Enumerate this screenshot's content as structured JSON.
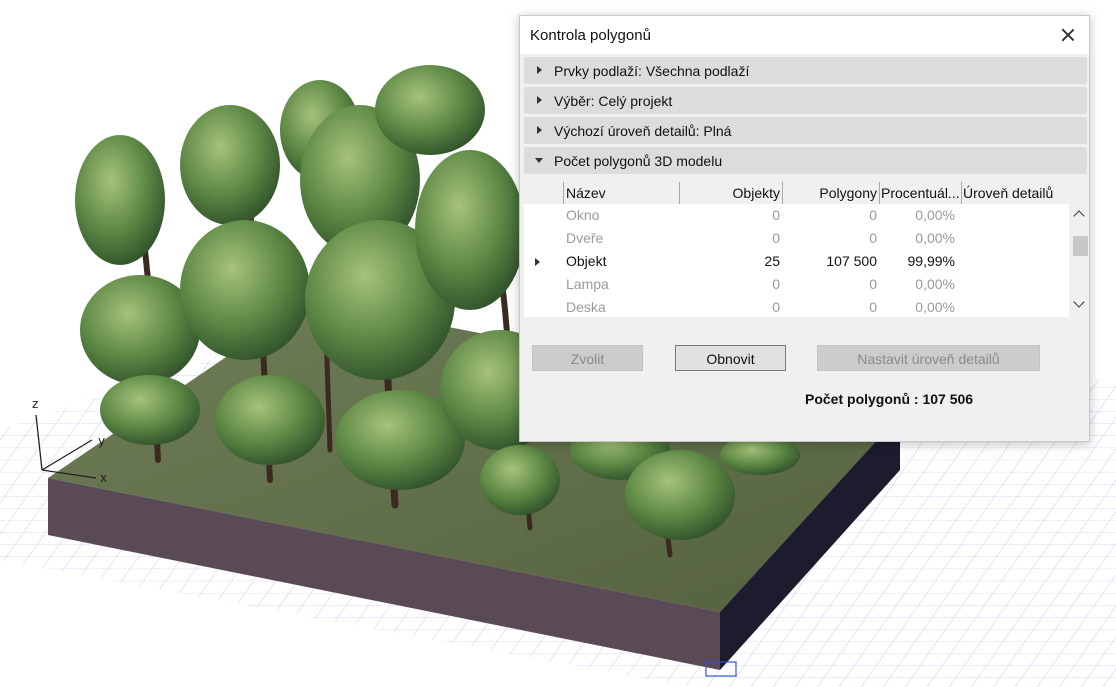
{
  "scene": {
    "axes": {
      "z": "z",
      "y": "y",
      "x": "x"
    }
  },
  "dialog": {
    "title": "Kontrola polygonů",
    "sections": [
      {
        "label": "Prvky podlaží: Všechna podlaží",
        "expanded": false
      },
      {
        "label": "Výběr: Celý projekt",
        "expanded": false
      },
      {
        "label": "Výchozí úroveň detailů: Plná",
        "expanded": false
      },
      {
        "label": "Počet polygonů 3D modelu",
        "expanded": true
      }
    ],
    "table": {
      "headers": {
        "name": "Název",
        "objects": "Objekty",
        "polygons": "Polygony",
        "percent": "Procentuál...",
        "detail": "Úroveň detailů"
      },
      "rows": [
        {
          "name": "Okno",
          "objects": "0",
          "polygons": "0",
          "percent": "0,00%",
          "detail": "",
          "active": false,
          "expandable": false
        },
        {
          "name": "Dveře",
          "objects": "0",
          "polygons": "0",
          "percent": "0,00%",
          "detail": "",
          "active": false,
          "expandable": false
        },
        {
          "name": "Objekt",
          "objects": "25",
          "polygons": "107 500",
          "percent": "99,99%",
          "detail": "",
          "active": true,
          "expandable": true
        },
        {
          "name": "Lampa",
          "objects": "0",
          "polygons": "0",
          "percent": "0,00%",
          "detail": "",
          "active": false,
          "expandable": false
        },
        {
          "name": "Deska",
          "objects": "0",
          "polygons": "0",
          "percent": "0,00%",
          "detail": "",
          "active": false,
          "expandable": false
        }
      ]
    },
    "buttons": {
      "select": "Zvolit",
      "refresh": "Obnovit",
      "set_detail": "Nastavit úroveň detailů"
    },
    "total": "Počet polygonů : 107 506"
  }
}
